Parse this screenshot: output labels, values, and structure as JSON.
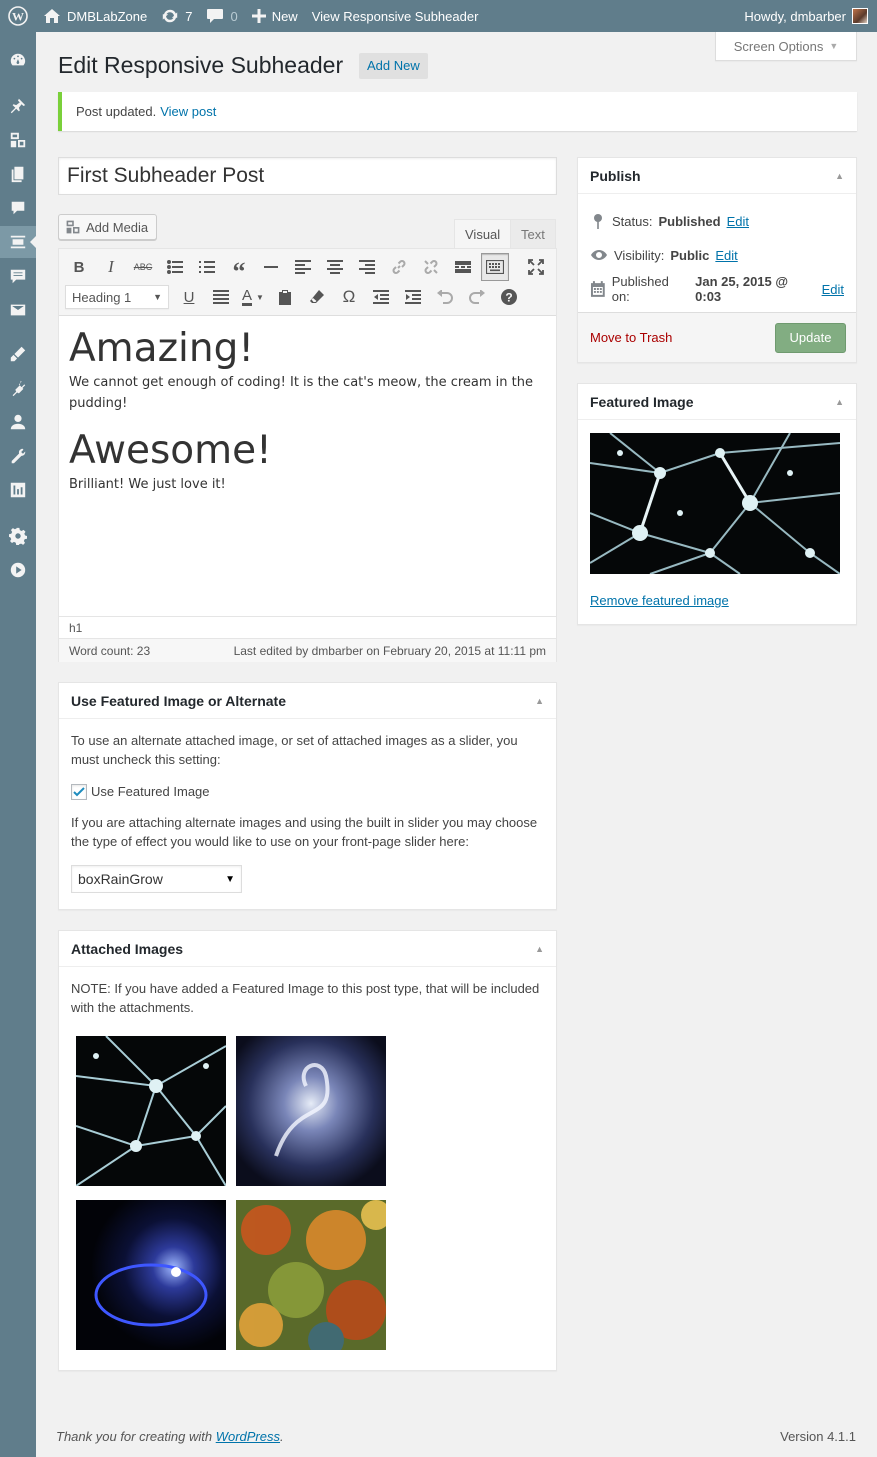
{
  "adminbar": {
    "site_name": "DMBLabZone",
    "updates_count": "7",
    "comments_count": "0",
    "new_label": "New",
    "view_label": "View Responsive Subheader",
    "howdy": "Howdy, dmbarber"
  },
  "sidebar": {
    "items": [
      "dashboard-icon",
      "posts-icon",
      "media-icon",
      "pages-icon",
      "comments-icon",
      "subheader-icon",
      "feedback-icon",
      "mail-icon",
      "appearance-icon",
      "plugins-icon",
      "users-icon",
      "tools-icon",
      "slider-icon",
      "settings-icon",
      "video-icon"
    ],
    "current": "subheader-icon"
  },
  "header": {
    "title": "Edit Responsive Subheader",
    "add_new": "Add New",
    "screen_options": "Screen Options"
  },
  "notice": {
    "text": "Post updated.",
    "link": "View post"
  },
  "post": {
    "title": "First Subheader Post"
  },
  "editor": {
    "add_media": "Add Media",
    "tab_visual": "Visual",
    "tab_text": "Text",
    "format": "Heading 1",
    "content": {
      "h1a": "Amazing!",
      "p1": "We cannot get enough of coding! It is the cat's meow, the cream in the pudding!",
      "h1b": "Awesome!",
      "p2": "Brilliant! We just love it!"
    },
    "path": "h1",
    "word_count": "Word count: 23",
    "last_edited": "Last edited by dmbarber on February 20, 2015 at 11:11 pm"
  },
  "publish": {
    "title": "Publish",
    "status_label": "Status:",
    "status_value": "Published",
    "visibility_label": "Visibility:",
    "visibility_value": "Public",
    "published_label": "Published on:",
    "published_value": "Jan 25, 2015 @ 0:03",
    "edit": "Edit",
    "trash": "Move to Trash",
    "update": "Update"
  },
  "featured": {
    "title": "Featured Image",
    "remove": "Remove featured image"
  },
  "use_featured": {
    "title": "Use Featured Image or Alternate",
    "desc": "To use an alternate attached image, or set of attached images as a slider, you must uncheck this setting:",
    "checkbox_label": "Use Featured Image",
    "desc2": "If you are attaching alternate images and using the built in slider you may choose the type of effect you would like to use on your front-page slider here:",
    "effect": "boxRainGrow"
  },
  "attached": {
    "title": "Attached Images",
    "note": "NOTE: If you have added a Featured Image to this post type, that will be included with the attachments."
  },
  "footer": {
    "thanks": "Thank you for creating with",
    "wp_link": "WordPress",
    "version": "Version 4.1.1"
  },
  "colors": {
    "admin_bar": "#607d8b",
    "link": "#0073aa",
    "notice_success": "#7ad03a",
    "update_button": "#82ad82",
    "trash": "#aa0000"
  }
}
